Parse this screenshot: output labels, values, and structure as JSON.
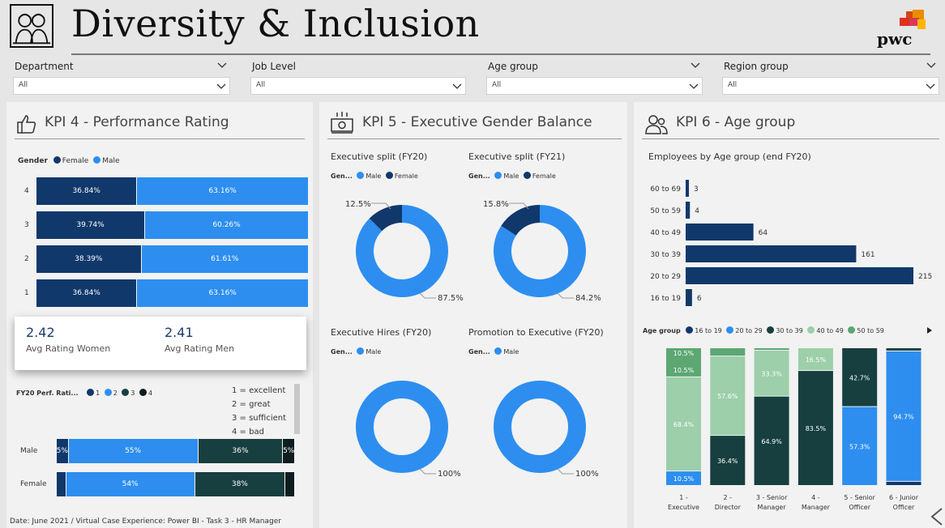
{
  "header": {
    "title": "Diversity & Inclusion",
    "logo_text": "pwc"
  },
  "filters": [
    {
      "label": "Department",
      "value": "All"
    },
    {
      "label": "Job Level",
      "value": "All"
    },
    {
      "label": "Age group",
      "value": "All"
    },
    {
      "label": "Region group",
      "value": "All"
    }
  ],
  "kpi4": {
    "title": "KPI 4 - Performance Rating",
    "legend_title": "Gender",
    "legend": [
      "Female",
      "Male"
    ],
    "colors": {
      "female": "#11386b",
      "male": "#2d8ef0"
    },
    "rows": [
      {
        "label": "4",
        "female": 36.84,
        "male": 63.16,
        "female_label": "36.84%",
        "male_label": "63.16%"
      },
      {
        "label": "3",
        "female": 39.74,
        "male": 60.26,
        "female_label": "39.74%",
        "male_label": "60.26%"
      },
      {
        "label": "2",
        "female": 38.39,
        "male": 61.61,
        "female_label": "38.39%",
        "male_label": "61.61%"
      },
      {
        "label": "1",
        "female": 36.84,
        "male": 63.16,
        "female_label": "36.84%",
        "male_label": "63.16%"
      }
    ],
    "card": {
      "women_value": "2.42",
      "women_label": "Avg Rating Women",
      "men_value": "2.41",
      "men_label": "Avg Rating Men"
    },
    "perf_legend_title": "FY20 Perf. Rati...",
    "perf_legend": [
      "1",
      "2",
      "3",
      "4"
    ],
    "perf_colors": [
      "#11386b",
      "#2d8ef0",
      "#173f3f",
      "#0e1e1e"
    ],
    "scale": [
      "1 = excellent",
      "2 = great",
      "3 = sufficient",
      "4 = bad"
    ],
    "perf_rows": [
      {
        "label": "Male",
        "segments": [
          5,
          55,
          36,
          5
        ],
        "labels": [
          "5%",
          "55%",
          "36%",
          "5%"
        ]
      },
      {
        "label": "Female",
        "segments": [
          4,
          54,
          38,
          4
        ],
        "labels": [
          "",
          "54%",
          "38%",
          ""
        ]
      }
    ]
  },
  "kpi5": {
    "title": "KPI 5 - Executive Gender Balance",
    "legend_title": "Gen...",
    "charts": [
      {
        "title": "Executive split (FY20)",
        "legend": [
          "Male",
          "Female"
        ],
        "male": 87.5,
        "female": 12.5,
        "male_label": "87.5%",
        "female_label": "12.5%"
      },
      {
        "title": "Executive split (FY21)",
        "legend": [
          "Male",
          "Female"
        ],
        "male": 84.2,
        "female": 15.8,
        "male_label": "84.2%",
        "female_label": "15.8%"
      },
      {
        "title": "Executive Hires (FY20)",
        "legend": [
          "Male"
        ],
        "male": 100,
        "female": 0,
        "male_label": "100%",
        "female_label": ""
      },
      {
        "title": "Promotion to Executive (FY20)",
        "legend": [
          "Male"
        ],
        "male": 100,
        "female": 0,
        "male_label": "100%",
        "female_label": ""
      }
    ]
  },
  "kpi6": {
    "title": "KPI 6 - Age group",
    "bar_title": "Employees by Age group (end FY20)",
    "age_bars": [
      {
        "label": "60 to 69",
        "value": 3
      },
      {
        "label": "50 to 59",
        "value": 4
      },
      {
        "label": "40 to 49",
        "value": 64
      },
      {
        "label": "30 to 39",
        "value": 161
      },
      {
        "label": "20 to 29",
        "value": 215
      },
      {
        "label": "16 to 19",
        "value": 6
      }
    ],
    "legend_title": "Age group",
    "legend": [
      "16 to 19",
      "20 to 29",
      "30 to 39",
      "40 to 49",
      "50 to 59"
    ],
    "colors": [
      "#11386b",
      "#2d8ef0",
      "#173f3f",
      "#9ccfaa",
      "#5ca772"
    ],
    "stack_columns": [
      {
        "label": "1 - Executive",
        "segments": [
          {
            "group": 0,
            "value": 0
          },
          {
            "group": 1,
            "value": 10.5
          },
          {
            "group": 2,
            "value": 0
          },
          {
            "group": 3,
            "value": 68.4
          },
          {
            "group": 4,
            "value": 21.1
          }
        ],
        "labels": [
          {
            "group": 1,
            "text": "10.5%"
          },
          {
            "group": 3,
            "text": "68.4%"
          },
          {
            "group": 4,
            "text": "10.5%"
          },
          {
            "group": 4,
            "text": "10.5%",
            "second": true
          }
        ]
      },
      {
        "label": "2 - Director",
        "segments": [
          {
            "group": 0,
            "value": 0
          },
          {
            "group": 1,
            "value": 0
          },
          {
            "group": 2,
            "value": 36.4
          },
          {
            "group": 3,
            "value": 57.6
          },
          {
            "group": 4,
            "value": 6.0
          }
        ],
        "labels": [
          {
            "group": 2,
            "text": "36.4%"
          },
          {
            "group": 3,
            "text": "57.6%"
          }
        ]
      },
      {
        "label": "3 - Senior Manager",
        "segments": [
          {
            "group": 0,
            "value": 0
          },
          {
            "group": 1,
            "value": 0
          },
          {
            "group": 2,
            "value": 64.9
          },
          {
            "group": 3,
            "value": 33.3
          },
          {
            "group": 4,
            "value": 1.8
          }
        ],
        "labels": [
          {
            "group": 2,
            "text": "64.9%"
          },
          {
            "group": 3,
            "text": "33.3%"
          }
        ]
      },
      {
        "label": "4 - Manager",
        "segments": [
          {
            "group": 0,
            "value": 0
          },
          {
            "group": 1,
            "value": 0
          },
          {
            "group": 2,
            "value": 83.5
          },
          {
            "group": 3,
            "value": 16.5
          },
          {
            "group": 4,
            "value": 0
          }
        ],
        "labels": [
          {
            "group": 2,
            "text": "83.5%"
          },
          {
            "group": 3,
            "text": "16.5%"
          }
        ]
      },
      {
        "label": "5 - Senior Officer",
        "segments": [
          {
            "group": 0,
            "value": 0
          },
          {
            "group": 1,
            "value": 57.3
          },
          {
            "group": 2,
            "value": 42.7
          },
          {
            "group": 3,
            "value": 0
          },
          {
            "group": 4,
            "value": 0
          }
        ],
        "labels": [
          {
            "group": 1,
            "text": "57.3%"
          },
          {
            "group": 2,
            "text": "42.7%"
          }
        ]
      },
      {
        "label": "6 - Junior Officer",
        "segments": [
          {
            "group": 0,
            "value": 3.0
          },
          {
            "group": 1,
            "value": 94.7
          },
          {
            "group": 2,
            "value": 2.3
          },
          {
            "group": 3,
            "value": 0
          },
          {
            "group": 4,
            "value": 0
          }
        ],
        "labels": [
          {
            "group": 1,
            "text": "94.7%"
          }
        ]
      }
    ]
  },
  "footer": "Date: June 2021 / Virtual Case Experience: Power BI - Task 3 - HR Manager"
}
